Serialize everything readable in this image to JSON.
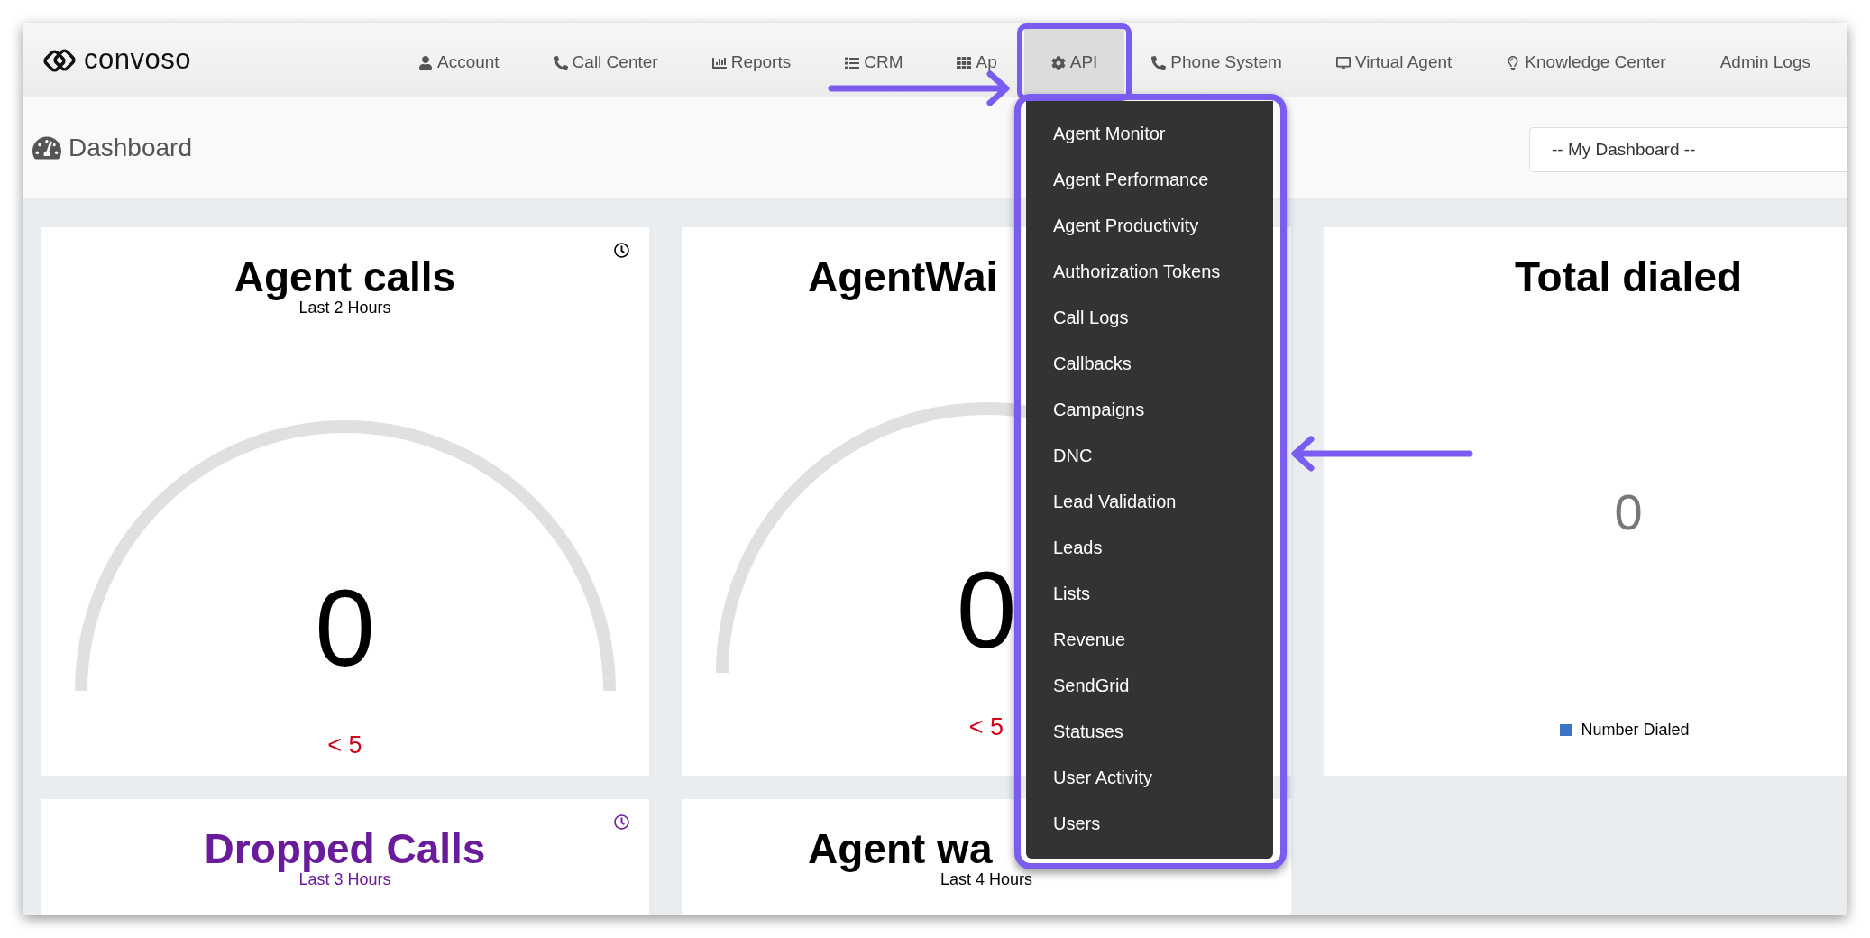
{
  "nav": {
    "logo": "convoso",
    "items": [
      {
        "label": "Account",
        "selected": false
      },
      {
        "label": "Call Center",
        "selected": false
      },
      {
        "label": "Reports",
        "selected": false
      },
      {
        "label": "CRM",
        "selected": false
      },
      {
        "label": "Ap",
        "selected": false
      },
      {
        "label": "API",
        "selected": true
      },
      {
        "label": "Phone System",
        "selected": false
      },
      {
        "label": "Virtual Agent",
        "selected": false
      },
      {
        "label": "Knowledge Center",
        "selected": false
      },
      {
        "label": "Admin Logs",
        "selected": false
      }
    ]
  },
  "page": {
    "title": "Dashboard",
    "dashboard_select": "-- My Dashboard --"
  },
  "dropdown": {
    "items": [
      "Agent Monitor",
      "Agent Performance",
      "Agent Productivity",
      "Authorization Tokens",
      "Call Logs",
      "Callbacks",
      "Campaigns",
      "DNC",
      "Lead Validation",
      "Leads",
      "Lists",
      "Revenue",
      "SendGrid",
      "Statuses",
      "User Activity",
      "Users"
    ]
  },
  "cards": [
    {
      "kind": "gauge",
      "title": "Agent calls",
      "subtitle": "Last 2 Hours",
      "value": "0",
      "threshold": "< 5",
      "color": "#000000",
      "clock": true,
      "covered": false
    },
    {
      "kind": "gauge",
      "title": "AgentWai",
      "value": "0",
      "threshold": "< 5",
      "color": "#000000",
      "covered": true
    },
    {
      "kind": "total",
      "title": "Total dialed",
      "value": "0",
      "legend": {
        "label": "Number Dialed",
        "color": "#3a75c4"
      },
      "color": "#000000",
      "covered": false
    },
    {
      "kind": "heading",
      "title": "Dropped Calls",
      "subtitle": "Last 3 Hours",
      "color": "#6a1b9a",
      "clock": true,
      "covered": false
    },
    {
      "kind": "heading",
      "title": "Agent wa",
      "subtitle": "Last 4 Hours",
      "color": "#000000",
      "covered": true
    }
  ]
}
